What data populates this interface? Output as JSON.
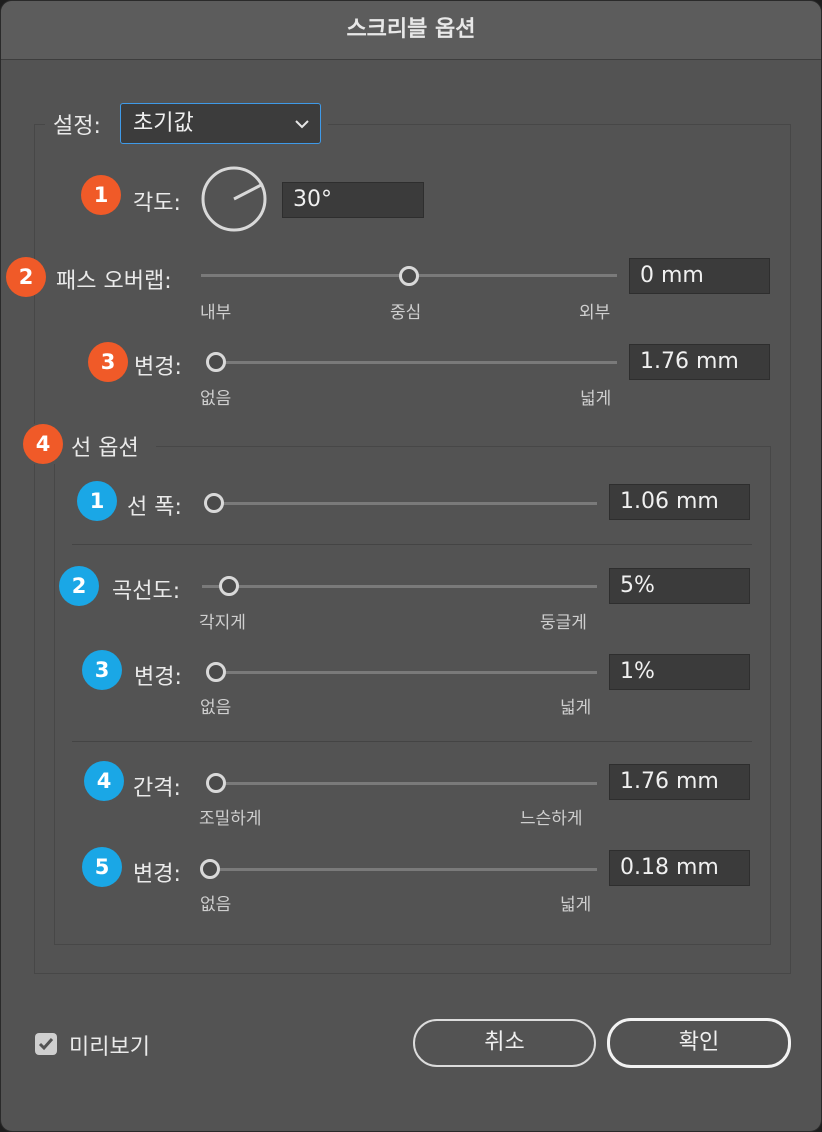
{
  "window": {
    "title": "스크리블 옵션"
  },
  "settings": {
    "label": "설정:",
    "value": "초기값"
  },
  "angle": {
    "badge": "1",
    "label": "각도:",
    "value": "30°"
  },
  "path_overlap": {
    "badge": "2",
    "label": "패스 오버랩:",
    "value": "0 mm",
    "min_label": "내부",
    "mid_label": "중심",
    "max_label": "외부",
    "slider_fraction": 0.5
  },
  "variation": {
    "badge": "3",
    "label": "변경:",
    "value": "1.76 mm",
    "min_label": "없음",
    "max_label": "넓게",
    "slider_fraction": 0.0
  },
  "line_options": {
    "badge": "4",
    "title": "선 옵션",
    "stroke_width": {
      "badge": "1",
      "label": "선 폭:",
      "value": "1.06 mm",
      "slider_fraction": 0.0
    },
    "curviness": {
      "badge": "2",
      "label": "곡선도:",
      "value": "5%",
      "min_label": "각지게",
      "max_label": "둥글게",
      "slider_fraction": 0.05
    },
    "curviness_variation": {
      "badge": "3",
      "label": "변경:",
      "value": "1%",
      "min_label": "없음",
      "max_label": "넓게",
      "slider_fraction": 0.0
    },
    "spacing": {
      "badge": "4",
      "label": "간격:",
      "value": "1.76 mm",
      "min_label": "조밀하게",
      "max_label": "느슨하게",
      "slider_fraction": 0.0
    },
    "spacing_variation": {
      "badge": "5",
      "label": "변경:",
      "value": "0.18 mm",
      "min_label": "없음",
      "max_label": "넓게",
      "slider_fraction": 0.0
    }
  },
  "preview": {
    "label": "미리보기",
    "checked": true
  },
  "buttons": {
    "cancel": "취소",
    "ok": "확인"
  },
  "colors": {
    "badge_red": "#f05a28",
    "badge_blue": "#1aa7e6",
    "focus": "#3f9ae8"
  }
}
